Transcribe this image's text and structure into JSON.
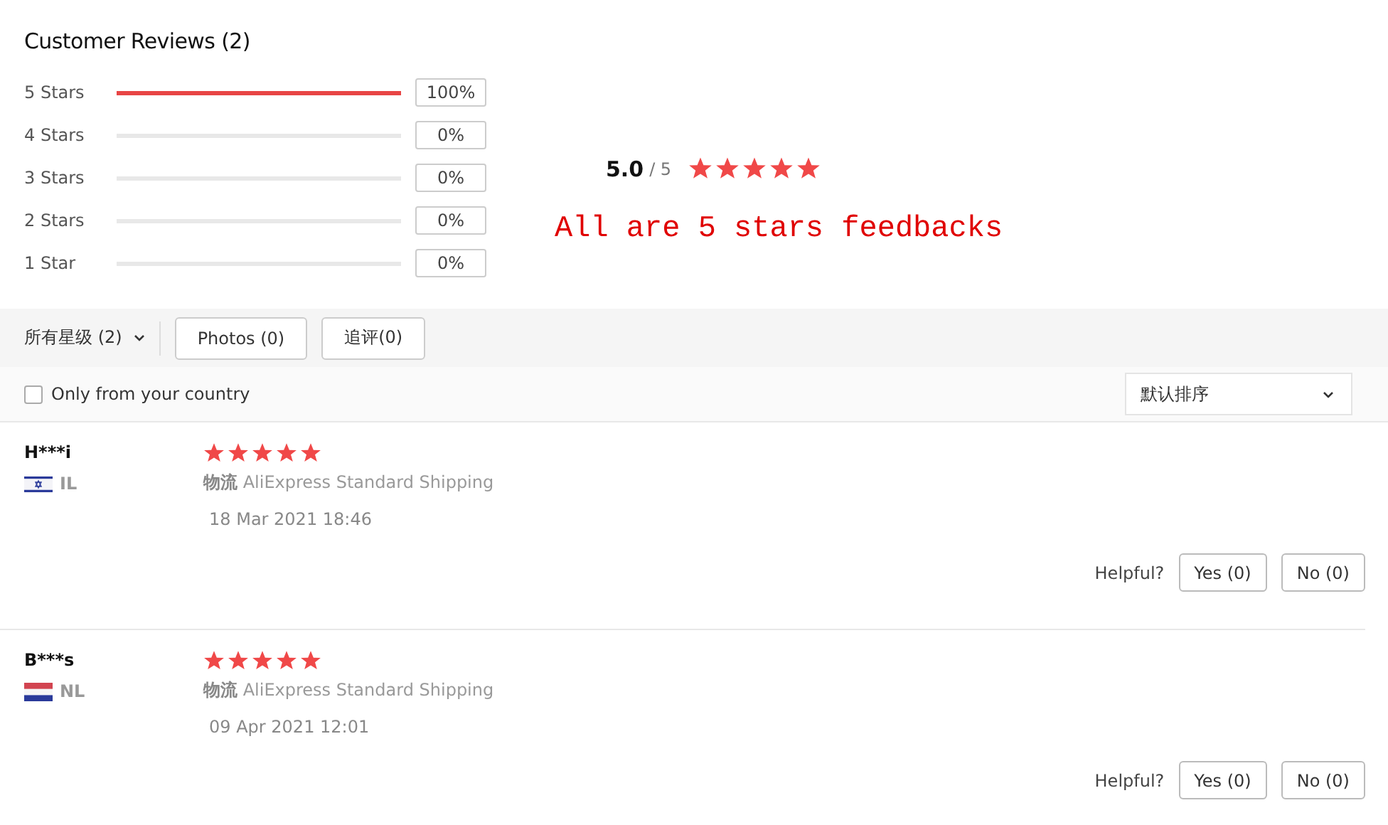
{
  "title": "Customer Reviews (2)",
  "distribution": [
    {
      "label": "5 Stars",
      "level": 1,
      "percent": "100%"
    },
    {
      "label": "4 Stars",
      "level": 0,
      "percent": "0%"
    },
    {
      "label": "3 Stars",
      "level": 0,
      "percent": "0%"
    },
    {
      "label": "2 Stars",
      "level": 0,
      "percent": "0%"
    },
    {
      "label": "1 Star",
      "level": 0,
      "percent": "0%"
    }
  ],
  "summary": {
    "score": "5.0",
    "out_of": "/ 5",
    "stars": 5
  },
  "note": "All are 5 stars feedbacks",
  "filters": {
    "star_filter": "所有星级 (2)",
    "buttons": [
      "Photos (0)",
      "追评(0)"
    ],
    "country_only": {
      "label": "Only from your country",
      "checked": false
    },
    "sort": "默认排序"
  },
  "reviews": [
    {
      "name": "H***i",
      "flag": {
        "kind": "star"
      },
      "country": "IL",
      "stars": 5,
      "shipping_label": "物流",
      "shipping": "AliExpress Standard Shipping",
      "date": "18 Mar 2021 18:46",
      "helpful": "Helpful?",
      "yes": "Yes (0)",
      "no": "No (0)"
    },
    {
      "name": "B***s",
      "flag": {
        "kind": "tricolor"
      },
      "country": "NL",
      "stars": 5,
      "shipping_label": "物流",
      "shipping": "AliExpress Standard Shipping",
      "date": "09 Apr 2021 12:01",
      "helpful": "Helpful?",
      "yes": "Yes (0)",
      "no": "No (0)"
    }
  ]
}
